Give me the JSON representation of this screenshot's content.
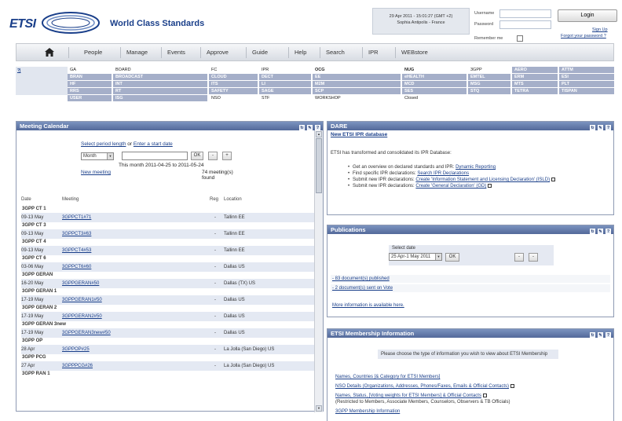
{
  "header": {
    "logo_text": "ETSI",
    "tagline": "World Class Standards",
    "date_line1": "29 Apr 2011 - 15:01:27 (GMT +2)",
    "date_line2": "Sophia Antipolis - France",
    "username_label": "Username",
    "password_label": "Password",
    "remember_label": "Remember me",
    "login_label": "Login",
    "signup_label": "Sign Up",
    "forgot_label": "Forgot your password ?"
  },
  "nav": [
    "People",
    "Manage",
    "Events",
    "Approve",
    "Guide",
    "Help",
    "Search",
    "IPR",
    "WEBstore"
  ],
  "sitemap": {
    "help": "?|",
    "rows": [
      [
        [
          "GA",
          "l"
        ],
        [
          "BOARD",
          "l"
        ],
        [
          "FC",
          "l"
        ],
        [
          "IPR",
          "l"
        ],
        [
          "OCG",
          "l"
        ],
        [
          "NUG",
          "l"
        ],
        [
          "3GPP",
          "l"
        ],
        [
          "AERO",
          "d"
        ],
        [
          "ATTM",
          "d"
        ]
      ],
      [
        [
          "BRAN",
          "d"
        ],
        [
          "BROADCAST",
          "d"
        ],
        [
          "CLOUD",
          "d"
        ],
        [
          "DECT",
          "d"
        ],
        [
          "EE",
          "d"
        ],
        [
          "eHEALTH",
          "d"
        ],
        [
          "EMTEL",
          "d"
        ],
        [
          "ERM",
          "d"
        ],
        [
          "ESI",
          "d"
        ]
      ],
      [
        [
          "HF",
          "d"
        ],
        [
          "INT",
          "d"
        ],
        [
          "ITS",
          "d"
        ],
        [
          "LI",
          "d"
        ],
        [
          "M2M",
          "d"
        ],
        [
          "MCD",
          "d"
        ],
        [
          "MSG",
          "d"
        ],
        [
          "MTS",
          "d"
        ],
        [
          "PLT",
          "d"
        ]
      ],
      [
        [
          "RRS",
          "d"
        ],
        [
          "RT",
          "d"
        ],
        [
          "SAFETY",
          "d"
        ],
        [
          "SAGE",
          "d"
        ],
        [
          "SCP",
          "d"
        ],
        [
          "SES",
          "d"
        ],
        [
          "STQ",
          "d"
        ],
        [
          "TETRA",
          "d"
        ],
        [
          "TISPAN",
          "d"
        ]
      ],
      [
        [
          "USER",
          "d"
        ],
        [
          "ISG",
          "d"
        ],
        [
          "NSO",
          "l"
        ],
        [
          "STF",
          "l"
        ],
        [
          "WORKSHOP",
          "l"
        ],
        [
          "Closed",
          "l"
        ]
      ]
    ]
  },
  "calendar": {
    "title": "Meeting Calendar",
    "period_prompt_1": "Select period length",
    "period_prompt_2": " or ",
    "period_prompt_3": "Enter a start date",
    "period_value": "Month",
    "ok_label": "OK",
    "prev_label": "-",
    "next_label": "+",
    "range_text": "This month 2011-04-25 to 2011-05-24",
    "new_meeting": "New meeting",
    "found_text": "74 meeting(s) found",
    "col_date": "Date",
    "col_meeting": "Meeting",
    "col_reg": "Reg",
    "col_location": "Location",
    "rows": [
      {
        "g": "3GPP CT 1"
      },
      {
        "d": "09-13 May",
        "m": "3GPPCT1#71",
        "r": "-",
        "l": "Tallinn EE"
      },
      {
        "g": "3GPP CT 3"
      },
      {
        "d": "09-13 May",
        "m": "3GPPCT3#63",
        "r": "-",
        "l": "Tallinn EE"
      },
      {
        "g": "3GPP CT 4"
      },
      {
        "d": "09-13 May",
        "m": "3GPPCT4#53",
        "r": "-",
        "l": "Tallinn EE"
      },
      {
        "g": "3GPP CT 6"
      },
      {
        "d": "03-06 May",
        "m": "3GPPCT6#60",
        "r": "-",
        "l": "Dallas US"
      },
      {
        "g": "3GPP GERAN"
      },
      {
        "d": "16-20 May",
        "m": "3GPPGERAN#50",
        "r": "-",
        "l": "Dallas (TX) US"
      },
      {
        "g": "3GPP GERAN 1"
      },
      {
        "d": "17-19 May",
        "m": "3GPPGERAN1#50",
        "r": "-",
        "l": "Dallas US"
      },
      {
        "g": "3GPP GERAN 2"
      },
      {
        "d": "17-19 May",
        "m": "3GPPGERAN2#50",
        "r": "-",
        "l": "Dallas US"
      },
      {
        "g": "3GPP GERAN 3new"
      },
      {
        "d": "17-19 May",
        "m": "3GPPGERAN3new#50",
        "r": "-",
        "l": "Dallas US"
      },
      {
        "g": "3GPP OP"
      },
      {
        "d": "28 Apr",
        "m": "3GPPOP#25",
        "r": "-",
        "l": "La Jolla (San Diego) US"
      },
      {
        "g": "3GPP PCG"
      },
      {
        "d": "27 Apr",
        "m": "3GPPPCG#26",
        "r": "-",
        "l": "La Jolla (San Diego) US"
      },
      {
        "g": "3GPP RAN 1"
      }
    ]
  },
  "dare": {
    "title": "DARE",
    "headline": "New ETSI IPR database",
    "intro": "ETSI has transformed and consolidated its IPR Database:",
    "items": [
      {
        "t": "Get an overview on declared standards and IPR: ",
        "l": "Dynamic Reporting"
      },
      {
        "t": "Find specific IPR declarations: ",
        "l": "Search IPR Declarations"
      },
      {
        "t": "Submit new IPR declarations: ",
        "l": "Create 'Information Statement and Licensing Declaration' (ISLD)"
      },
      {
        "t": "Submit new IPR declarations: ",
        "l": "Create 'General Declaration' (GD)"
      }
    ]
  },
  "publications": {
    "title": "Publications",
    "select_label": "Select date",
    "select_value": "25 Apr-1 May 2011",
    "ok_label": "OK",
    "prev_label": "-",
    "next_label": "-",
    "line1": "- 83 document(s) published",
    "line2": "- 2 document(s) sent on Vote",
    "more": "More information is available here."
  },
  "membership": {
    "title": "ETSI Membership Information",
    "intro": "Please choose the type of information you wish to view about ETSI Membership",
    "links": [
      {
        "t": "Names, Countries [& Category for ETSI Members]",
        "lock": false
      },
      {
        "t": "NSO Details (Organizations, Addresses, Phones/Faxes, Emails & Official Contacts)",
        "lock": true
      },
      {
        "t": "Names, Status, [Voting weights for ETSI Members] & Official Contacts",
        "lock": true
      },
      {
        "t": "3GPP Membership Information",
        "lock": false
      }
    ],
    "restricted_note": "(Restricted to Members, Associate Members, Counselors, Observers & TB Officials)"
  },
  "colors": {
    "panel_head": "#53699a",
    "sitemap_dark": "#a5afc9",
    "row_bg": "#e4e9f3",
    "brand": "#1a3f8a"
  }
}
